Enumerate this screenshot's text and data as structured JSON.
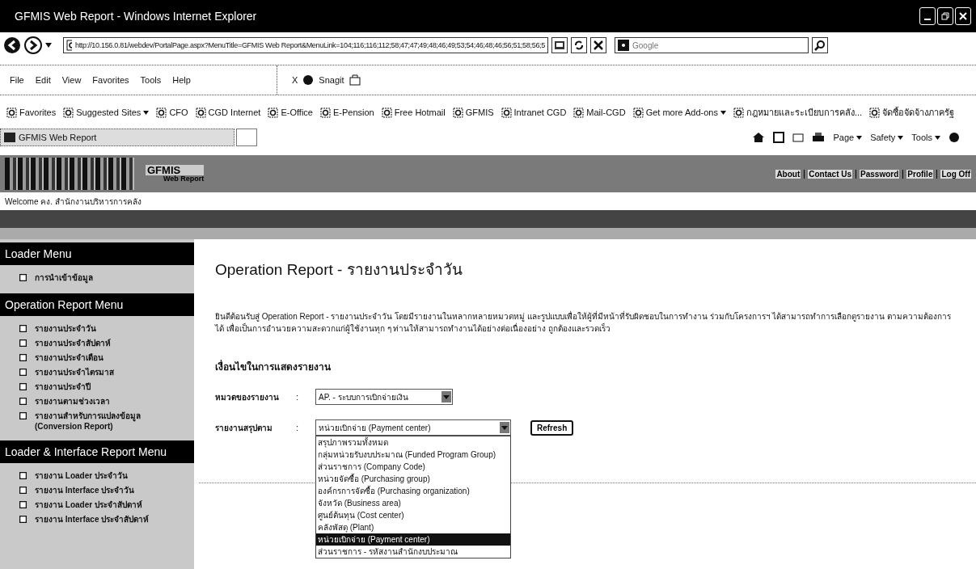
{
  "window": {
    "title": "GFMIS Web Report - Windows Internet Explorer"
  },
  "address_bar": {
    "url": "http://10.156.0.81/webdev/PortalPage.aspx?MenuTitle=GFMIS Web Report&MenuLink=104;116;116;112;58;47;47;49;48;46;49;53;54;46;48;46;56;51;58;56;5"
  },
  "search": {
    "placeholder": "Google"
  },
  "menu_bar": [
    "File",
    "Edit",
    "View",
    "Favorites",
    "Tools",
    "Help"
  ],
  "snagit_toolbar": {
    "close": "X",
    "label": "Snagit"
  },
  "favorites_bar": [
    {
      "label": "Favorites",
      "has_menu": false
    },
    {
      "label": "Suggested Sites",
      "has_menu": true
    },
    {
      "label": "CFO",
      "has_menu": false
    },
    {
      "label": "CGD Internet",
      "has_menu": false
    },
    {
      "label": "E-Office",
      "has_menu": false
    },
    {
      "label": "E-Pension",
      "has_menu": false
    },
    {
      "label": "Free Hotmail",
      "has_menu": false
    },
    {
      "label": "GFMIS",
      "has_menu": false
    },
    {
      "label": "Intranet CGD",
      "has_menu": false
    },
    {
      "label": "Mail-CGD",
      "has_menu": false
    },
    {
      "label": "Get more Add-ons",
      "has_menu": true
    },
    {
      "label": "กฎหมายและระเบียบการคลัง...",
      "has_menu": false
    },
    {
      "label": "จัดซื้อจัดจ้างภาครัฐ",
      "has_menu": false
    }
  ],
  "tab": {
    "label": "GFMIS Web Report"
  },
  "command_bar": [
    "Page",
    "Safety",
    "Tools"
  ],
  "site": {
    "logo": "GFMIS",
    "logo_sub": "Web Report",
    "links": [
      "About",
      "Contact Us",
      "Password",
      "Profile",
      "Log Off"
    ],
    "welcome": "Welcome คง. สำนักงานบริหารการคลัง"
  },
  "sidebar": [
    {
      "heading": "Loader Menu",
      "items": [
        "การนำเข้าข้อมูล"
      ]
    },
    {
      "heading": "Operation Report Menu",
      "items": [
        "รายงานประจำวัน",
        "รายงานประจำสัปดาห์",
        "รายงานประจำเดือน",
        "รายงานประจำไตรมาส",
        "รายงานประจำปี",
        "รายงานตามช่วงเวลา",
        "รายงานสำหรับการแปลงข้อมูล (Conversion Report)"
      ]
    },
    {
      "heading": "Loader & Interface Report Menu",
      "items": [
        "รายงาน Loader ประจำวัน",
        "รายงาน Interface ประจำวัน",
        "รายงาน Loader ประจำสัปดาห์",
        "รายงาน Interface ประจำสัปดาห์"
      ]
    }
  ],
  "main": {
    "title": "Operation Report - รายงานประจำวัน",
    "intro": "ยินดีต้อนรับสู่ Operation Report - รายงานประจำวัน โดยมีรายงานในหลากหลายหมวดหมู่ และรูปแบบเพื่อให้ผู้ที่มีหน้าที่รับผิดชอบในการทำงาน ร่วมกับโครงการฯ ได้สามารถทำการเลือกดูรายงาน ตามความต้องการ ได้ เพื่อเป็นการอำนวยความสะดวกแก่ผู้ใช้งานทุก ๆ ท่านให้สามารถทำงานได้อย่างต่อเนื่องอย่าง ถูกต้องและรวดเร็ว",
    "filter_heading": "เงื่อนไขในการแสดงรายงาน",
    "fields": [
      {
        "label": "หมวดของรายงาน",
        "separator": ":",
        "value": "AP. - ระบบการเบิกจ่ายเงิน"
      },
      {
        "label": "รายงานสรุปตาม",
        "separator": ":",
        "value": "หน่วยเบิกจ่าย (Payment center)"
      }
    ],
    "button": "Refresh",
    "options": [
      {
        "label": "สรุปภาพรวมทั้งหมด",
        "selected": false
      },
      {
        "label": "กลุ่มหน่วยรับงบประมาณ (Funded Program Group)",
        "selected": false
      },
      {
        "label": "ส่วนราชการ (Company Code)",
        "selected": false
      },
      {
        "label": "หน่วยจัดซื้อ (Purchasing group)",
        "selected": false
      },
      {
        "label": "องค์กรการจัดซื้อ (Purchasing organization)",
        "selected": false
      },
      {
        "label": "จังหวัด (Business area)",
        "selected": false
      },
      {
        "label": "ศูนย์ต้นทุน (Cost center)",
        "selected": false
      },
      {
        "label": "คลังพัสดุ (Plant)",
        "selected": false
      },
      {
        "label": "หน่วยเบิกจ่าย (Payment center)",
        "selected": true
      },
      {
        "label": "ส่วนราชการ - รหัสงานสำนักงบประมาณ",
        "selected": false
      }
    ]
  }
}
